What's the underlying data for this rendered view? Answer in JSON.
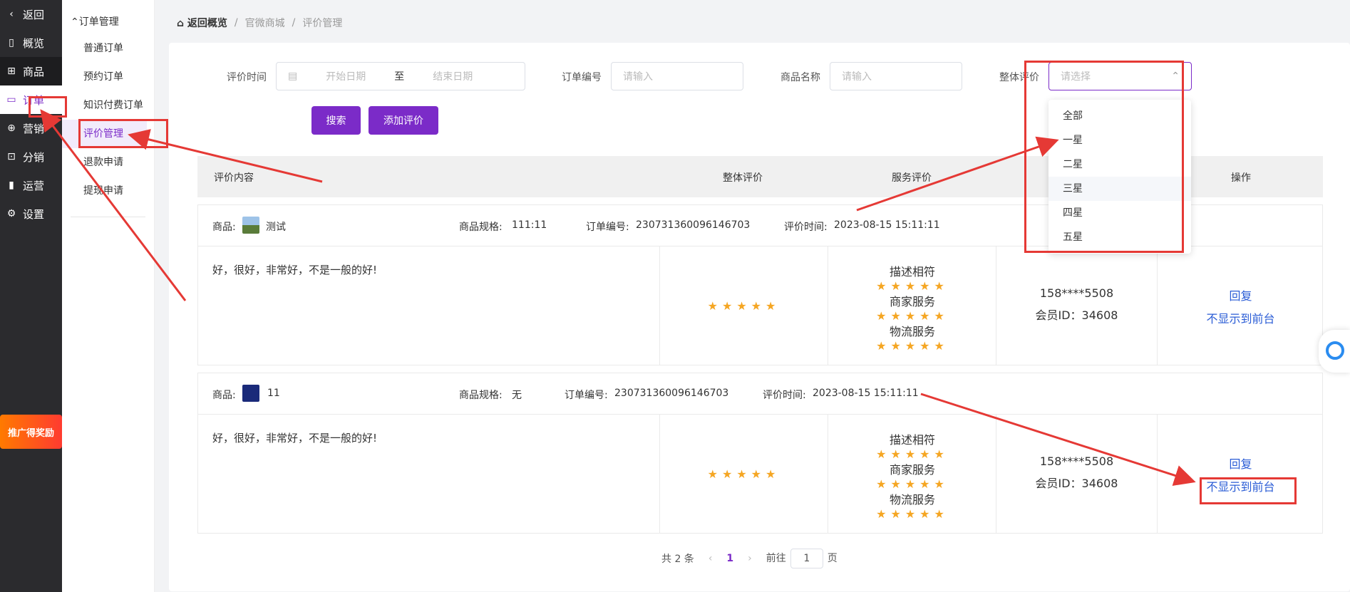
{
  "nav1": {
    "items": [
      {
        "icon": "back-icon",
        "glyph": "‹",
        "label": "返回"
      },
      {
        "icon": "overview-icon",
        "glyph": "▯",
        "label": "概览"
      },
      {
        "icon": "goods-icon",
        "glyph": "⊞",
        "label": "商品"
      },
      {
        "icon": "order-icon",
        "glyph": "▭",
        "label": "订单"
      },
      {
        "icon": "marketing-icon",
        "glyph": "⊕",
        "label": "营销"
      },
      {
        "icon": "distribution-icon",
        "glyph": "⊡",
        "label": "分销"
      },
      {
        "icon": "operation-icon",
        "glyph": "▮",
        "label": "运营"
      },
      {
        "icon": "settings-icon",
        "glyph": "⚙",
        "label": "设置"
      }
    ],
    "promo": "推广得奖励"
  },
  "nav2": {
    "group": "订单管理",
    "items": [
      "普通订单",
      "预约订单",
      "知识付费订单",
      "评价管理",
      "退款申请",
      "提现申请"
    ]
  },
  "breadcrumb": {
    "home": "返回概览",
    "mall": "官微商城",
    "current": "评价管理"
  },
  "filters": {
    "time_label": "评价时间",
    "start_ph": "开始日期",
    "to": "至",
    "end_ph": "结束日期",
    "order_label": "订单编号",
    "order_ph": "请输入",
    "goods_label": "商品名称",
    "goods_ph": "请输入",
    "rating_label": "整体评价",
    "rating_ph": "请选择"
  },
  "buttons": {
    "search": "搜索",
    "add": "添加评价"
  },
  "table": {
    "headers": {
      "content": "评价内容",
      "overall": "整体评价",
      "service": "服务评价",
      "action": "操作"
    }
  },
  "dropdown": [
    "全部",
    "一星",
    "二星",
    "三星",
    "四星",
    "五星"
  ],
  "records": [
    {
      "goods_label": "商品:",
      "goods_name": "测试",
      "spec_label": "商品规格:",
      "spec": "111:11",
      "order_label": "订单编号:",
      "order_no": "230731360096146703",
      "time_label": "评价时间:",
      "time": "2023-08-15 15:11:11",
      "content": "好，很好，非常好，不是一般的好!",
      "overall_stars": "★★★★★",
      "svc1": "描述相符",
      "svc2": "商家服务",
      "svc3": "物流服务",
      "stars1": "★★★★★",
      "stars2": "★★★★★",
      "stars3": "★★★★★",
      "phone": "158****5508",
      "member": "会员ID：34608",
      "reply": "回复",
      "hide": "不显示到前台"
    },
    {
      "goods_label": "商品:",
      "goods_name": "11",
      "spec_label": "商品规格:",
      "spec": "无",
      "order_label": "订单编号:",
      "order_no": "230731360096146703",
      "time_label": "评价时间:",
      "time": "2023-08-15 15:11:11",
      "content": "好，很好，非常好，不是一般的好!",
      "overall_stars": "★★★★★",
      "svc1": "描述相符",
      "svc2": "商家服务",
      "svc3": "物流服务",
      "stars1": "★★★★★",
      "stars2": "★★★★★",
      "stars3": "★★★★★",
      "phone": "158****5508",
      "member": "会员ID：34608",
      "reply": "回复",
      "hide": "不显示到前台"
    }
  ],
  "pager": {
    "total": "共 2 条",
    "page": "1",
    "goto": "前往",
    "goto_value": "1",
    "unit": "页"
  },
  "colors": {
    "accent": "#7b2bc8",
    "annotation": "#e53935",
    "star": "#f5a623",
    "link": "#2a5cd6"
  }
}
